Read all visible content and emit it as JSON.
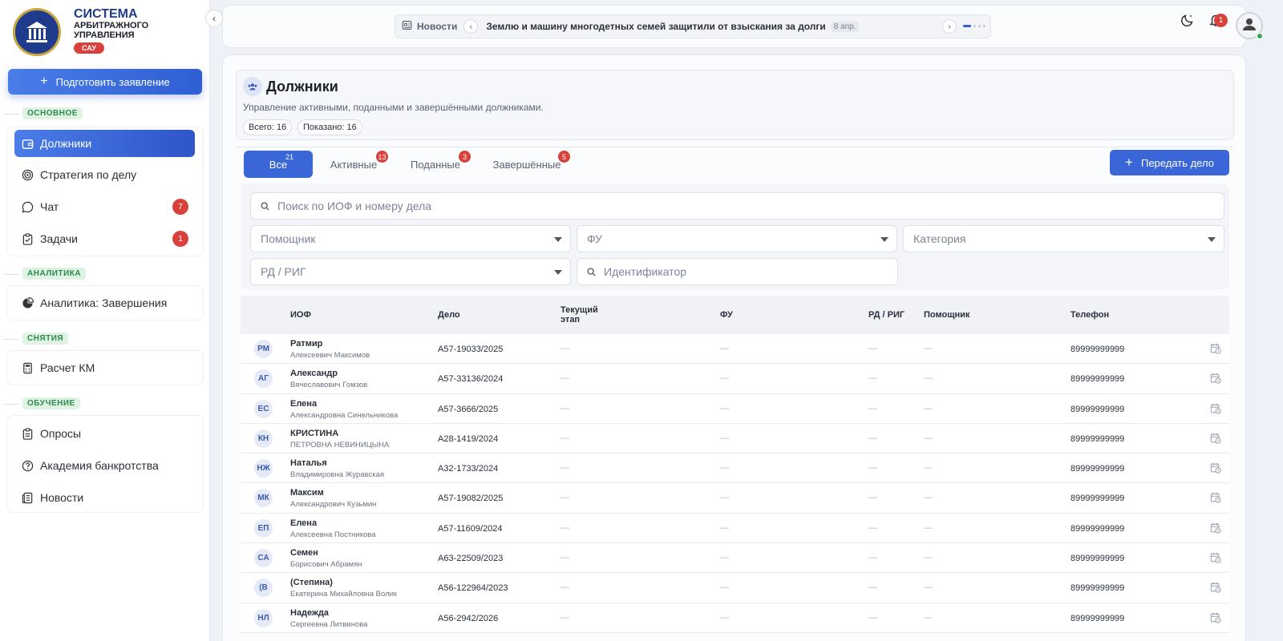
{
  "brand": {
    "title": "СИСТЕМА",
    "line2": "АРБИТРАЖНОГО",
    "line3": "УПРАВЛЕНИЯ",
    "badge": "САУ"
  },
  "sidebar": {
    "prepare_label": "Подготовить заявление",
    "sections": {
      "main": "ОСНОВНОЕ",
      "analytics": "АНАЛИТИКА",
      "removals": "СНЯТИЯ",
      "training": "ОБУЧЕНИЕ"
    },
    "items": [
      {
        "label": "Должники",
        "icon": "wallet-icon"
      },
      {
        "label": "Стратегия по делу",
        "icon": "target-icon"
      },
      {
        "label": "Чат",
        "icon": "chat-icon",
        "badge": "7"
      },
      {
        "label": "Задачи",
        "icon": "clipboard-check-icon",
        "badge": "1"
      },
      {
        "label": "Аналитика: Завершения",
        "icon": "pie-chart-icon"
      },
      {
        "label": "Расчет КМ",
        "icon": "calculator-icon"
      },
      {
        "label": "Опросы",
        "icon": "clipboard-list-icon"
      },
      {
        "label": "Академия банкротства",
        "icon": "help-circle-icon"
      },
      {
        "label": "Новости",
        "icon": "newspaper-icon"
      }
    ]
  },
  "topbar": {
    "news_label": "Новости",
    "news_text": "Землю и машину многодетных семей защитили от взыскания за долги",
    "news_date": "8 апр.",
    "notif_count": "1"
  },
  "page": {
    "title": "Должники",
    "description": "Управление активными, поданными и завершёнными должниками.",
    "total": "Всего: 16",
    "shown": "Показано: 16"
  },
  "tabs": [
    {
      "label": "Все",
      "count": "21"
    },
    {
      "label": "Активные",
      "count": "13"
    },
    {
      "label": "Поданные",
      "count": "3"
    },
    {
      "label": "Завершённые",
      "count": "5"
    }
  ],
  "transfer_label": "Передать дело",
  "filters": {
    "search_placeholder": "Поиск по ИОФ и номеру дела",
    "assistant": "Помощник",
    "fu": "ФУ",
    "category": "Категория",
    "rd": "РД / РИГ",
    "identifier": "Идентификатор"
  },
  "table": {
    "headers": {
      "name": "ИОФ",
      "case": "Дело",
      "stage1": "Текущий",
      "stage2": "этап",
      "fu": "ФУ",
      "rd": "РД / РИГ",
      "assistant": "Помощник",
      "phone": "Телефон"
    },
    "dash": "—",
    "rows": [
      {
        "initials": "РМ",
        "first": "Ратмир",
        "rest": "Алексеевич Максимов",
        "case": "А57-19033/2025",
        "phone": "89999999999"
      },
      {
        "initials": "АГ",
        "first": "Александр",
        "rest": "Вячеславович Гомзов",
        "case": "А57-33136/2024",
        "phone": "89999999999"
      },
      {
        "initials": "ЕС",
        "first": "Елена",
        "rest": "Александровна Синельникова",
        "case": "А57-3666/2025",
        "phone": "89999999999"
      },
      {
        "initials": "КН",
        "first": "КРИСТИНА",
        "rest": "ПЕТРОВНА НЕВИНИЦЫНА",
        "case": "А28-1419/2024",
        "phone": "89999999999"
      },
      {
        "initials": "НЖ",
        "first": "Наталья",
        "rest": "Владимировна Журавская",
        "case": "А32-1733/2024",
        "phone": "89999999999"
      },
      {
        "initials": "МК",
        "first": "Максим",
        "rest": "Александрович Кузьмин",
        "case": "А57-19082/2025",
        "phone": "89999999999"
      },
      {
        "initials": "ЕП",
        "first": "Елена",
        "rest": "Алексеевна Постникова",
        "case": "А57-11609/2024",
        "phone": "89999999999"
      },
      {
        "initials": "СА",
        "first": "Семен",
        "rest": "Борисович Абрамян",
        "case": "А63-22509/2023",
        "phone": "89999999999"
      },
      {
        "initials": "(В",
        "first": "(Степина)",
        "rest": "Екатерина Михайловна Волик",
        "case": "А56-122964/2023",
        "phone": "89999999999"
      },
      {
        "initials": "НЛ",
        "first": "Надежда",
        "rest": "Сергеевна Литвинова",
        "case": "А56-2942/2026",
        "phone": "89999999999"
      }
    ]
  }
}
